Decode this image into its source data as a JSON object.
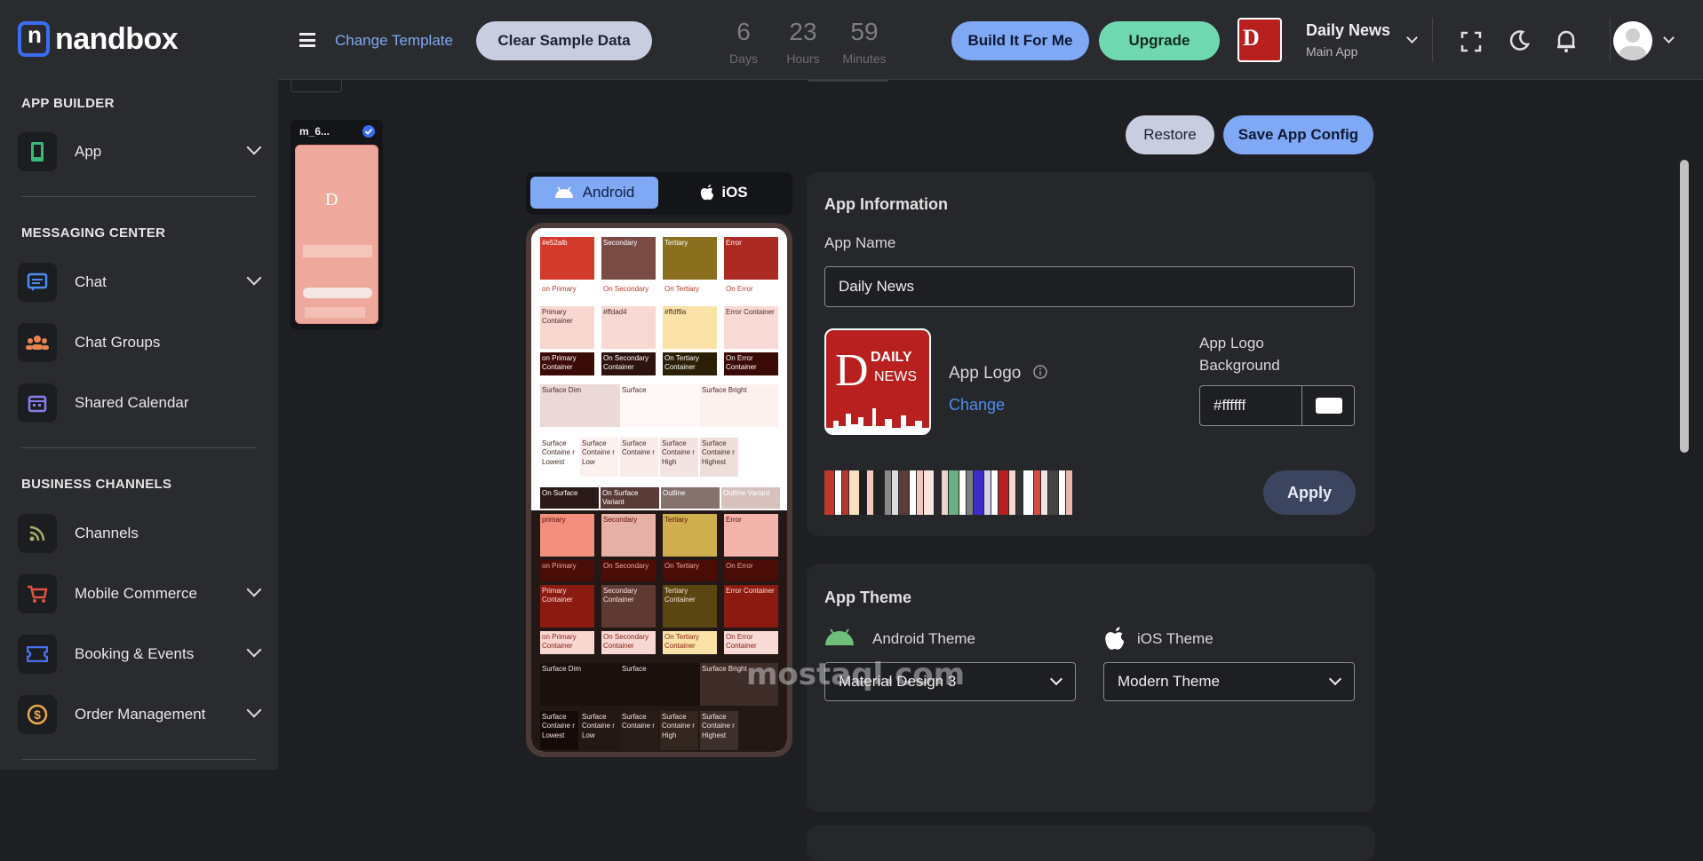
{
  "brand": {
    "name": "nandbox"
  },
  "sidebar": {
    "sections": [
      {
        "title": "APP BUILDER"
      },
      {
        "title": "MESSAGING CENTER"
      },
      {
        "title": "BUSINESS CHANNELS"
      }
    ],
    "items": [
      {
        "label": "App",
        "icon": "phone-icon"
      },
      {
        "label": "Chat",
        "icon": "chat-icon"
      },
      {
        "label": "Chat Groups",
        "icon": "group-icon"
      },
      {
        "label": "Shared Calendar",
        "icon": "calendar-icon"
      },
      {
        "label": "Channels",
        "icon": "rss-icon"
      },
      {
        "label": "Mobile Commerce",
        "icon": "cart-icon"
      },
      {
        "label": "Booking & Events",
        "icon": "ticket-icon"
      },
      {
        "label": "Order Management",
        "icon": "dollar-icon"
      }
    ]
  },
  "topbar": {
    "change_template": "Change Template",
    "clear_sample": "Clear Sample Data",
    "timer": {
      "days": "6",
      "days_label": "Days",
      "hours": "23",
      "hours_label": "Hours",
      "minutes": "59",
      "minutes_label": "Minutes"
    },
    "build": "Build It For Me",
    "upgrade": "Upgrade",
    "app_name": "Daily News",
    "app_sub": "Main App"
  },
  "thumbnail": {
    "name": "m_6..."
  },
  "platform_tabs": {
    "android": "Android",
    "ios": "iOS"
  },
  "actions": {
    "restore": "Restore",
    "save": "Save App Config"
  },
  "app_info": {
    "title": "App Information",
    "name_label": "App Name",
    "name_value": "Daily News",
    "logo_label": "App Logo",
    "logo_change": "Change",
    "logo_bg_label": "App Logo Background",
    "logo_bg_value": "#ffffff",
    "apply": "Apply"
  },
  "app_theme": {
    "title": "App Theme",
    "android_label": "Android Theme",
    "android_value": "Material Design 3",
    "ios_label": "iOS Theme",
    "ios_value": "Modern Theme"
  },
  "palette_light": {
    "row1": [
      "#e52alb",
      "Secondary",
      "Tertiary",
      "Error"
    ],
    "row2": [
      "on Primary",
      "On Secondary",
      "On Tertiary",
      "On Error"
    ],
    "row3": [
      "Primary Container",
      "#ffdad4",
      "#ffdf9a",
      "Error Container"
    ],
    "row4": [
      "on Primary Container",
      "On Secondary Container",
      "On Tertiary Container",
      "On Error Container"
    ],
    "surface": [
      "Surface Dim",
      "Surface",
      "Surface Bright"
    ],
    "containers": [
      "Surface Containe r Lowest",
      "Surface Containe r Low",
      "Surface Containe r",
      "Surface Containe r High",
      "Surface Containe r Highest"
    ],
    "bottom": [
      "On Surface",
      "On Surface Variant",
      "Outline",
      "Outline Variant"
    ]
  },
  "palette_dark": {
    "row1": [
      "primary",
      "Secondary",
      "Tertiary",
      "Error"
    ],
    "row2": [
      "on Primary",
      "On Secondary",
      "On Tertiary",
      "On Error"
    ],
    "row3": [
      "Primary Container",
      "Secondary Container",
      "Tertiary Container",
      "Error Container"
    ],
    "row4": [
      "on Primary Container",
      "On Secondary Container",
      "On Tertiary Container",
      "On Error Container"
    ],
    "surface": [
      "Surface Dim",
      "Surface",
      "Surface Bright"
    ],
    "containers": [
      "Surface Containe r Lowest",
      "Surface Containe r Low",
      "Surface Containe r",
      "Surface Containe r High",
      "Surface Containe r Highest"
    ]
  },
  "watermark": "mostaql.com",
  "colors": {
    "accent": "#7fa8f5",
    "accent_blue": "#3b6df4",
    "upgrade": "#6fd8b0",
    "gray_pill": "#c8cde0"
  }
}
